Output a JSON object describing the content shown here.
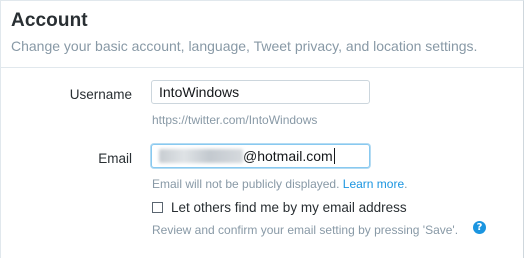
{
  "header": {
    "title": "Account",
    "subtitle": "Change your basic account, language, Tweet privacy, and location settings."
  },
  "username": {
    "label": "Username",
    "value": "IntoWindows",
    "profile_url": "https://twitter.com/IntoWindows"
  },
  "email": {
    "label": "Email",
    "value_visible": "@hotmail.com",
    "note": "Email will not be publicly displayed.",
    "learn_more": "Learn more",
    "learn_more_suffix": "."
  },
  "discoverability": {
    "checkbox_label": "Let others find me by my email address",
    "checked": false,
    "review_text": "Review and confirm your email setting by pressing 'Save'.",
    "help_icon": "?"
  },
  "colors": {
    "link": "#1b95e0",
    "muted": "#8899a6",
    "focus_border": "#88c9f0"
  },
  "icons": {
    "help": "question-circle-icon"
  }
}
